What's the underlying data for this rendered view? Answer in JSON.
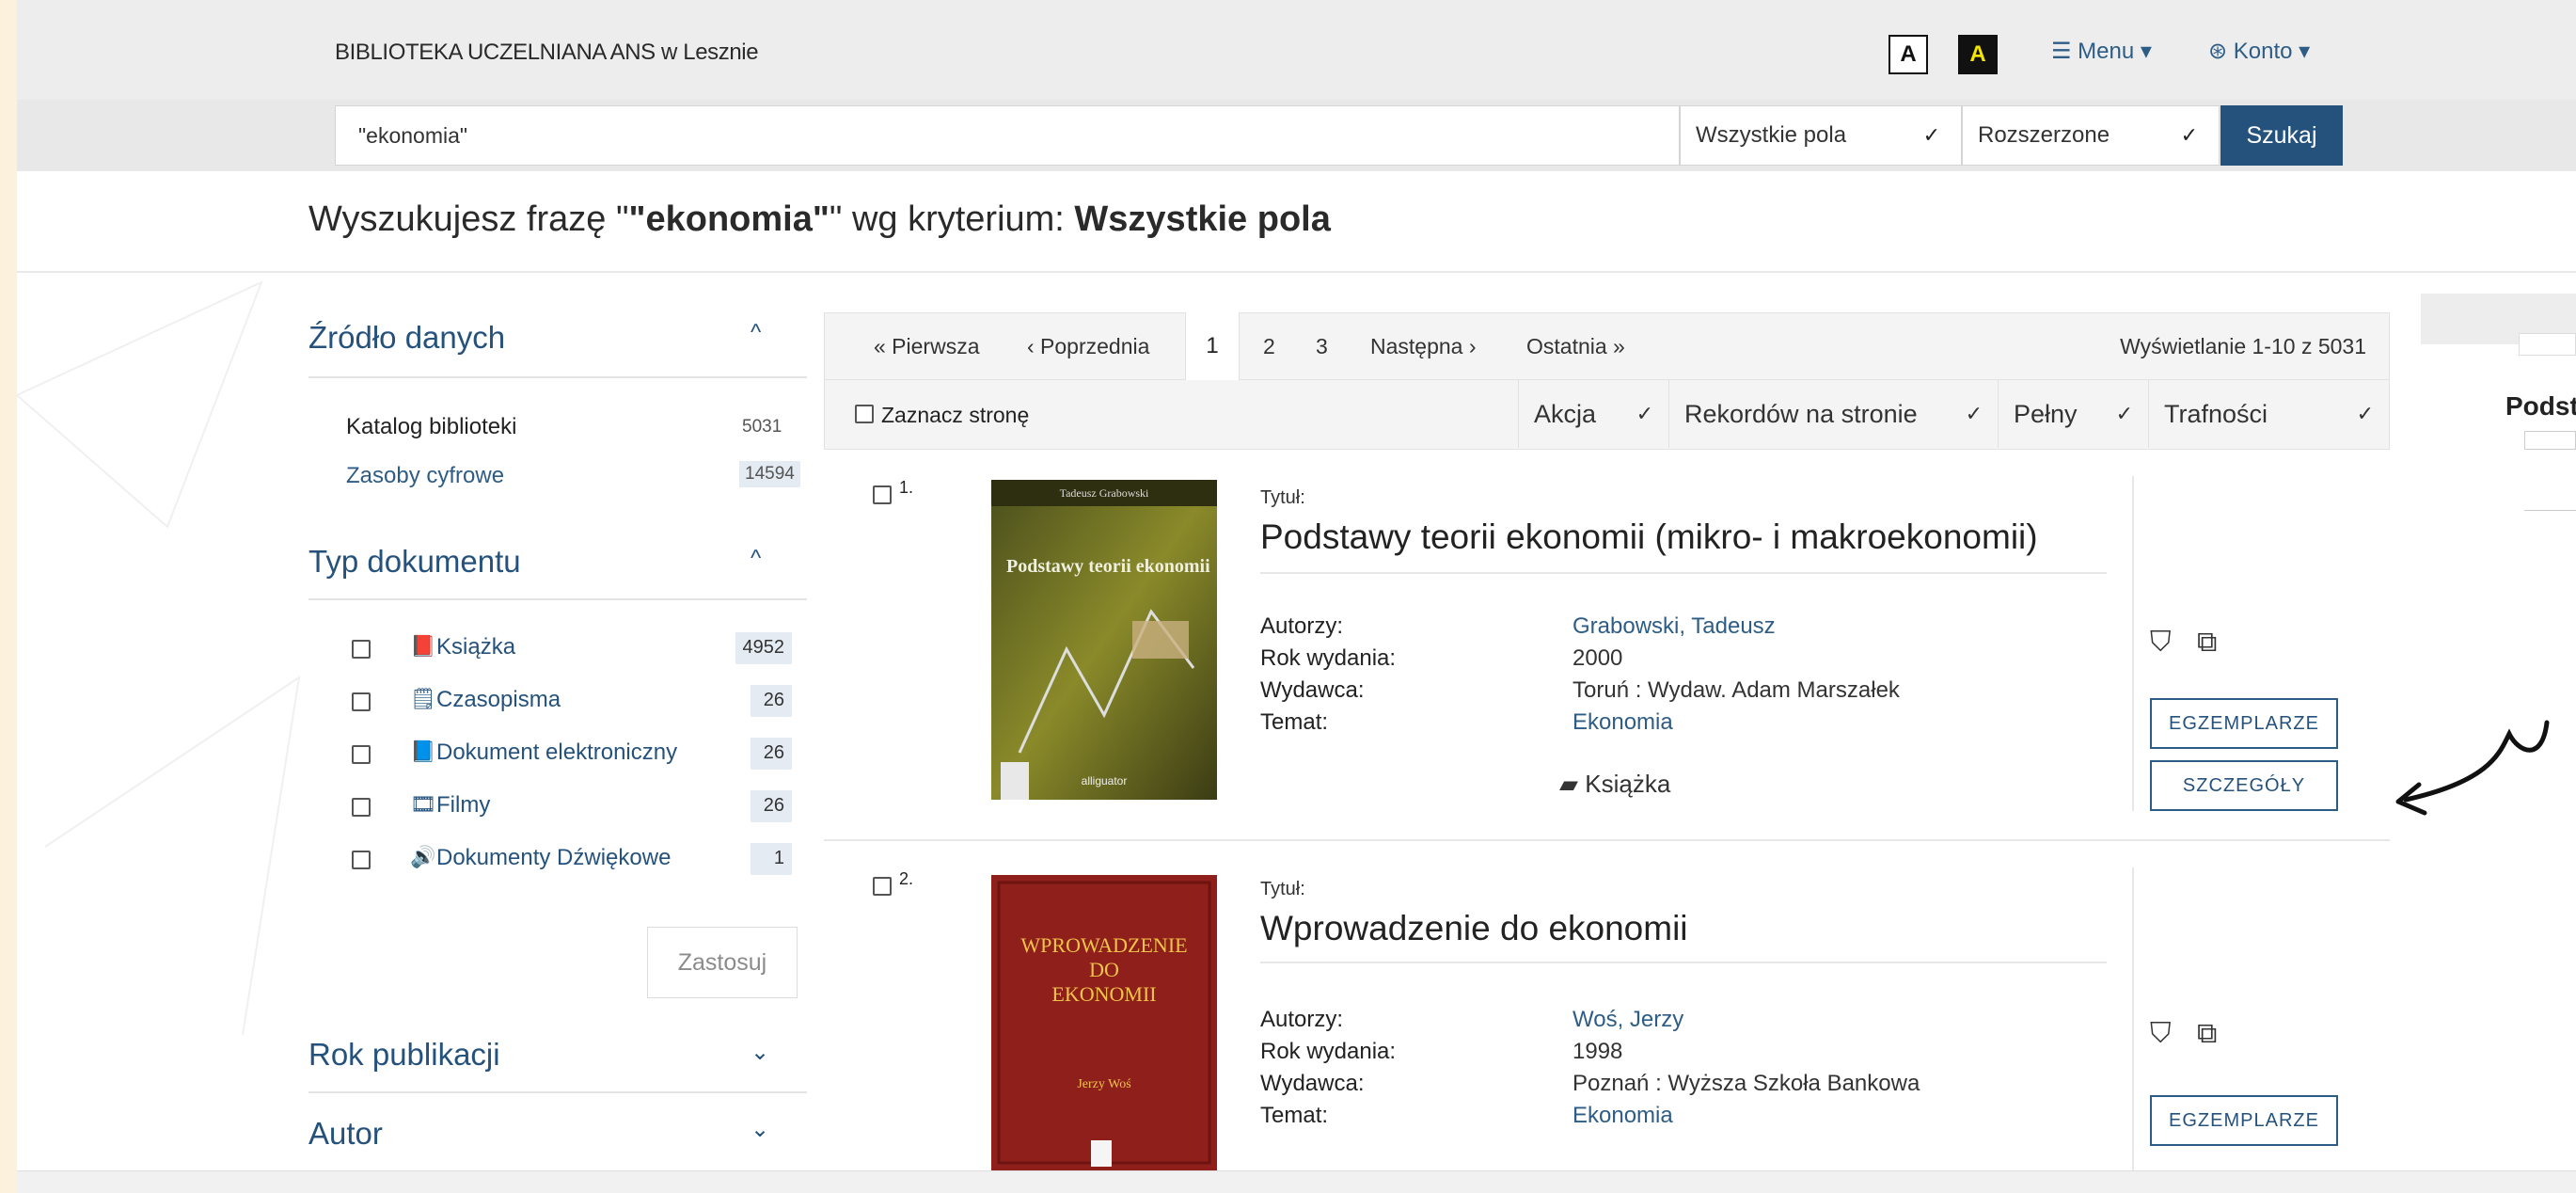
{
  "header": {
    "brand": "BIBLIOTEKA UCZELNIANA ANS w Lesznie",
    "contrast_normal": "A",
    "contrast_high": "A",
    "menu": "☰ Menu ▾",
    "account": "⊛ Konto ▾"
  },
  "search": {
    "query": "\"ekonomia\"",
    "field": "Wszystkie pola",
    "mode": "Rozszerzone",
    "button": "Szukaj"
  },
  "phrase": {
    "prefix": "Wyszukujesz frazę \"",
    "term": "\"ekonomia\"",
    "middle": "\" wg kryterium: ",
    "criterion": "Wszystkie pola"
  },
  "facets": {
    "source": {
      "title": "Źródło danych",
      "items": [
        {
          "label": "Katalog biblioteki",
          "count": "5031"
        },
        {
          "label": "Zasoby cyfrowe",
          "count": "14594"
        }
      ]
    },
    "doc_type": {
      "title": "Typ dokumentu",
      "items": [
        {
          "icon": "book-icon",
          "glyph": "📕",
          "label": "Książka",
          "count": "4952"
        },
        {
          "icon": "journal-icon",
          "glyph": "🗒",
          "label": "Czasopisma",
          "count": "26"
        },
        {
          "icon": "ebook-icon",
          "glyph": "📘",
          "label": "Dokument elektroniczny",
          "count": "26"
        },
        {
          "icon": "film-icon",
          "glyph": "🎞",
          "label": "Filmy",
          "count": "26"
        },
        {
          "icon": "audio-icon",
          "glyph": "🔊",
          "label": "Dokumenty Dźwiękowe",
          "count": "1"
        }
      ],
      "apply": "Zastosuj"
    },
    "year": {
      "title": "Rok publikacji"
    },
    "author": {
      "title": "Autor"
    }
  },
  "pager": {
    "first": "« Pierwsza",
    "prev": "‹ Poprzednia",
    "pages": [
      "1",
      "2",
      "3"
    ],
    "next": "Następna ›",
    "last": "Ostatnia »",
    "status": "Wyświetlanie 1-10 z 5031"
  },
  "toolbar": {
    "select_page": "Zaznacz stronę",
    "action": "Akcja",
    "per_page": "Rekordów na stronie",
    "view": "Pełny",
    "sort": "Trafności"
  },
  "labels": {
    "title": "Tytuł:",
    "authors": "Autorzy:",
    "year": "Rok wydania:",
    "publisher": "Wydawca:",
    "subject": "Temat:",
    "copies": "EGZEMPLARZE",
    "details": "SZCZEGÓŁY"
  },
  "records": [
    {
      "num": "1.",
      "title": "Podstawy teorii ekonomii (mikro- i makroekonomii)",
      "author": "Grabowski, Tadeusz",
      "year": "2000",
      "publisher": "Toruń : Wydaw. Adam Marszałek",
      "subject": "Ekonomia",
      "type": "Książka",
      "cover_author": "Tadeusz Grabowski",
      "cover_title": "Podstawy teorii ekonomii"
    },
    {
      "num": "2.",
      "title": "Wprowadzenie do ekonomii",
      "author": "Woś, Jerzy",
      "year": "1998",
      "publisher": "Poznań : Wyższa Szkoła Bankowa",
      "subject": "Ekonomia",
      "cover_title": "WPROWADZENIE DO EKONOMII",
      "cover_author": "Jerzy Woś"
    }
  ],
  "thumbnail": {
    "title": "Podst"
  },
  "colors": {
    "accent": "#25527c",
    "link": "#2d5d86",
    "frame": "#fbf1dc"
  }
}
